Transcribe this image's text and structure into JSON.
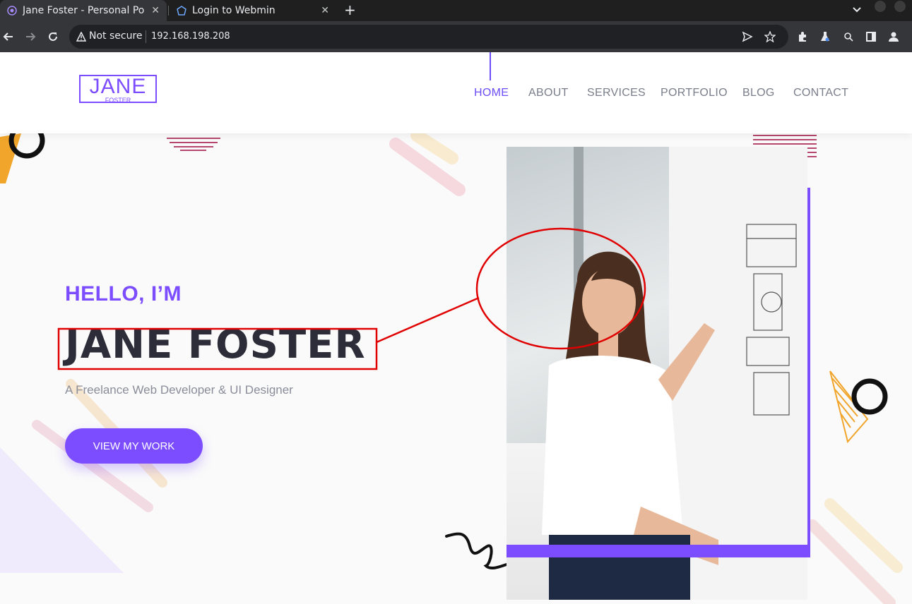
{
  "browser": {
    "tabs": [
      {
        "title": "Jane Foster - Personal Po",
        "active": true
      },
      {
        "title": "Login to Webmin",
        "active": false
      }
    ],
    "security_label": "Not secure",
    "url": "192.168.198.208",
    "icons": [
      "back-icon",
      "forward-icon",
      "reload-icon",
      "warning-icon",
      "send-icon",
      "star-icon",
      "extensions-icon",
      "labs-icon",
      "search-icon",
      "sidepanel-icon",
      "profile-icon"
    ]
  },
  "site": {
    "logo": {
      "top": "JANE",
      "bottom": "FOSTER"
    },
    "nav": [
      "HOME",
      "ABOUT",
      "SERVICES",
      "PORTFOLIO",
      "BLOG",
      "CONTACT"
    ],
    "active_nav": "HOME",
    "hero": {
      "greeting": "HELLO, I’M",
      "name": "JANE FOSTER",
      "subtitle": "A Freelance Web Developer & UI Designer",
      "cta": "VIEW MY WORK"
    },
    "colors": {
      "accent": "#7c4dff",
      "heading": "#2d2d3a",
      "annotation": "#e00000"
    }
  }
}
